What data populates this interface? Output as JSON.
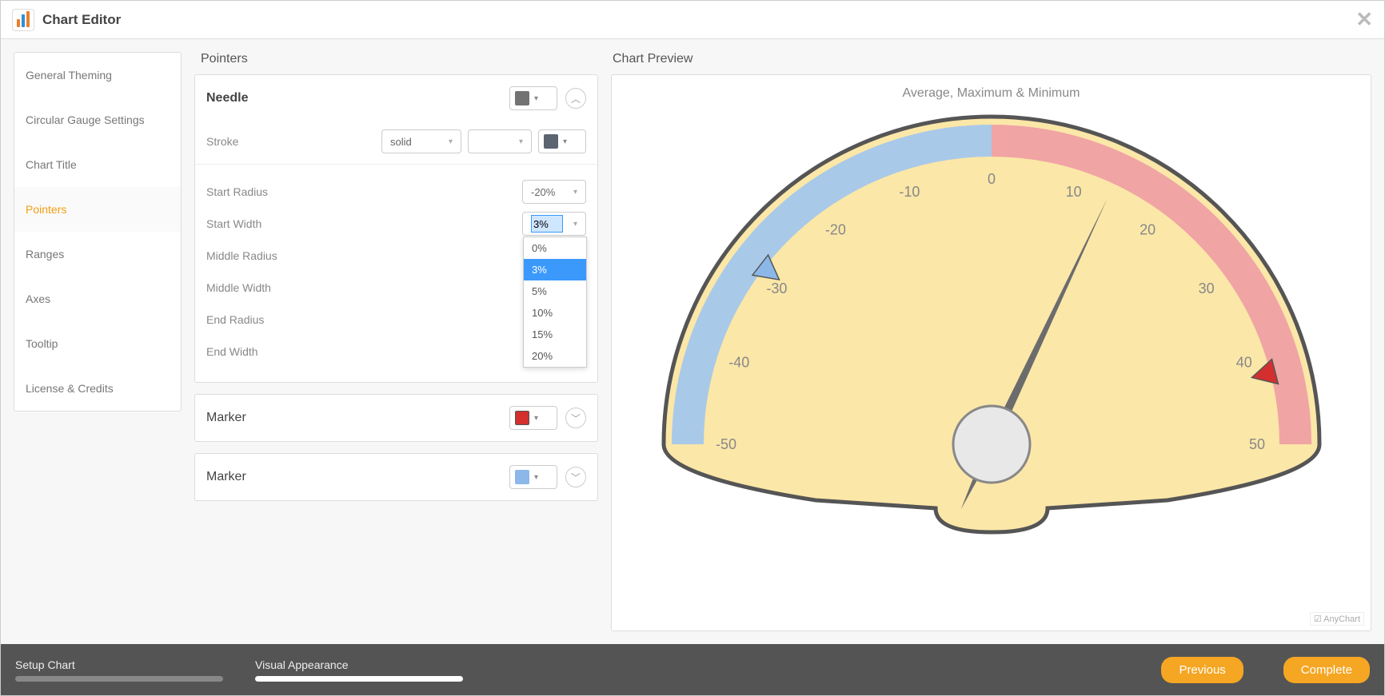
{
  "window": {
    "title": "Chart Editor"
  },
  "sidebar": {
    "items": [
      {
        "label": "General Theming"
      },
      {
        "label": "Circular Gauge Settings"
      },
      {
        "label": "Chart Title"
      },
      {
        "label": "Pointers",
        "active": true
      },
      {
        "label": "Ranges"
      },
      {
        "label": "Axes"
      },
      {
        "label": "Tooltip"
      },
      {
        "label": "License & Credits"
      }
    ]
  },
  "mid": {
    "heading": "Pointers",
    "needle": {
      "title": "Needle",
      "color": "#737373",
      "stroke_label": "Stroke",
      "stroke_style": "solid",
      "stroke_color": "#5b6470",
      "start_radius_label": "Start Radius",
      "start_radius_value": "-20%",
      "start_width_label": "Start Width",
      "start_width_value": "3%",
      "start_width_options": [
        "0%",
        "3%",
        "5%",
        "10%",
        "15%",
        "20%"
      ],
      "middle_radius_label": "Middle Radius",
      "middle_width_label": "Middle Width",
      "end_radius_label": "End Radius",
      "end_width_label": "End Width"
    },
    "markers": [
      {
        "title": "Marker",
        "color": "#d32f2f"
      },
      {
        "title": "Marker",
        "color": "#8bb8e8"
      }
    ]
  },
  "preview": {
    "heading": "Chart Preview",
    "title": "Average, Maximum & Minimum",
    "credit": "AnyChart"
  },
  "chart_data": {
    "type": "gauge",
    "title": "Average, Maximum & Minimum",
    "axis": {
      "min": -50,
      "max": 50,
      "ticks": [
        -50,
        -40,
        -30,
        -20,
        -10,
        0,
        10,
        20,
        30,
        40,
        50
      ]
    },
    "ranges": [
      {
        "from": -50,
        "to": 0,
        "color": "#a9c9e8"
      },
      {
        "from": 0,
        "to": 50,
        "color": "#f0a4a4"
      }
    ],
    "pointers": {
      "needle": {
        "value": 14,
        "color": "#737373"
      },
      "marker_min": {
        "value": -29,
        "color": "#8bb8e8",
        "shape": "triangle"
      },
      "marker_max": {
        "value": 42,
        "color": "#d32f2f",
        "shape": "triangle"
      }
    },
    "background": "#fbe7a8"
  },
  "footer": {
    "step1": "Setup Chart",
    "step2": "Visual Appearance",
    "prev": "Previous",
    "complete": "Complete"
  }
}
